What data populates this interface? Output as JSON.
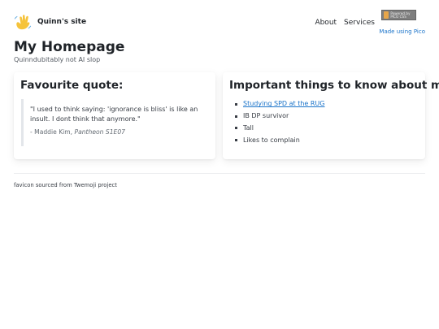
{
  "header": {
    "brand_name": "Quinn's site",
    "brand_icon": "waving-hand-icon",
    "nav": [
      {
        "label": "About"
      },
      {
        "label": "Services"
      }
    ],
    "badge_icon": "pico-badge-icon",
    "badge_text": "Powered by PICO CSS",
    "made_using": "Made using Pico"
  },
  "main": {
    "title": "My Homepage",
    "subtitle": "Quinndubitably not AI slop"
  },
  "quote_card": {
    "heading": "Favourite quote:",
    "quote": "\"I used to think saying: 'ignorance is bliss' is like an insult. I dont think that anymore.\"",
    "author_prefix": "- Maddie Kim, ",
    "author_source": "Pantheon S1E07"
  },
  "facts_card": {
    "heading": "Important things to know about me:",
    "items": [
      {
        "label": "Studying SPD at the RUG"
      },
      {
        "label": "IB DP survivor"
      },
      {
        "label": "Tall"
      },
      {
        "label": "Likes to complain"
      }
    ]
  },
  "footer": {
    "text": "favicon sourced from Twemoji project"
  },
  "colors": {
    "accent_link": "#1a73c9",
    "text": "#373c44",
    "heading": "#1f2328",
    "hand": "#f5c33b"
  }
}
